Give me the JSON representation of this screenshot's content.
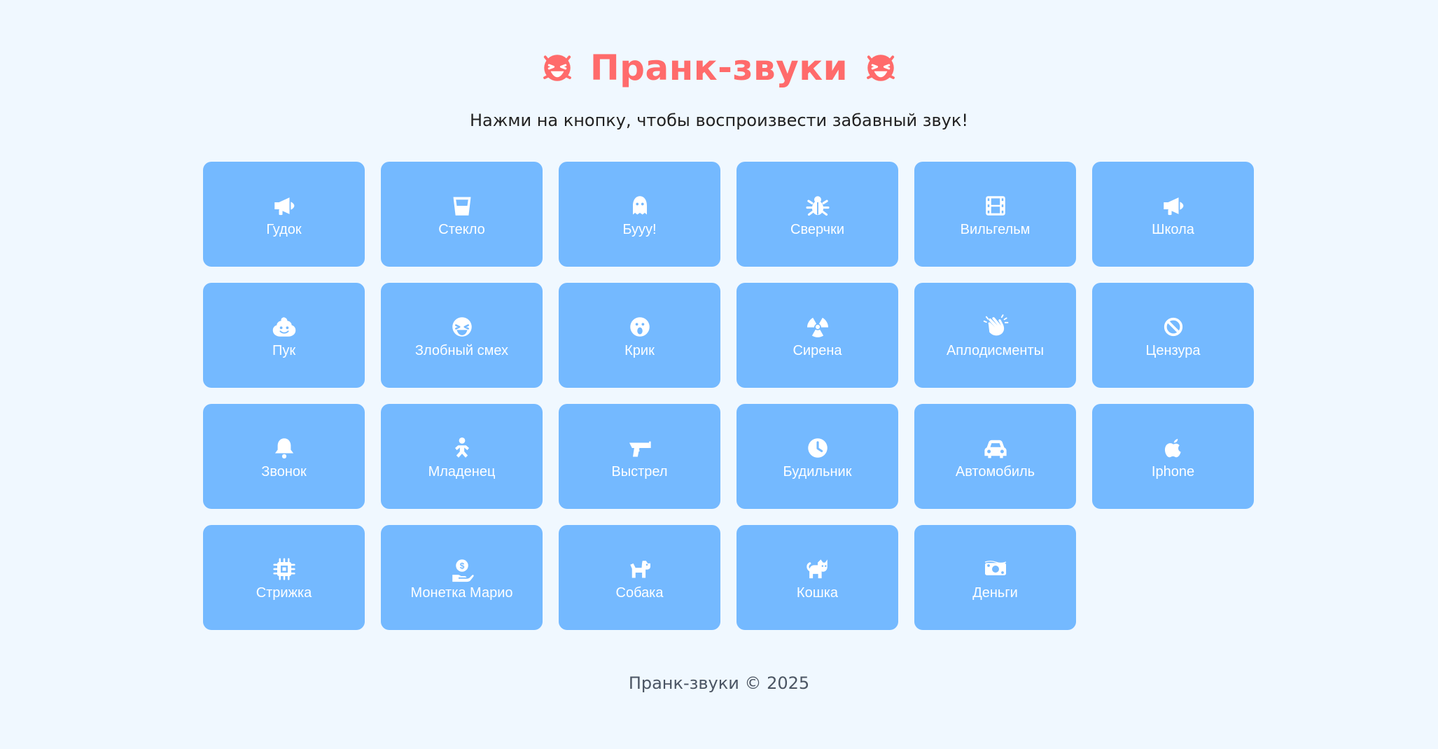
{
  "header": {
    "title": "Пранк-звуки",
    "subtitle": "Нажми на кнопку, чтобы воспроизвести забавный звук!",
    "title_icon_left": "laugh-squint-icon",
    "title_icon_right": "laugh-squint-icon"
  },
  "buttons": [
    {
      "label": "Гудок",
      "icon": "megaphone-icon"
    },
    {
      "label": "Стекло",
      "icon": "glass-icon"
    },
    {
      "label": "Бууу!",
      "icon": "ghost-icon"
    },
    {
      "label": "Сверчки",
      "icon": "bug-icon"
    },
    {
      "label": "Вильгельм",
      "icon": "film-icon"
    },
    {
      "label": "Школа",
      "icon": "megaphone-icon"
    },
    {
      "label": "Пук",
      "icon": "poop-icon"
    },
    {
      "label": "Злобный смех",
      "icon": "laugh-squint-icon"
    },
    {
      "label": "Крик",
      "icon": "surprise-icon"
    },
    {
      "label": "Сирена",
      "icon": "radiation-icon"
    },
    {
      "label": "Аплодисменты",
      "icon": "hands-clapping-icon"
    },
    {
      "label": "Цензура",
      "icon": "ban-icon"
    },
    {
      "label": "Звонок",
      "icon": "bell-icon"
    },
    {
      "label": "Младенец",
      "icon": "baby-icon"
    },
    {
      "label": "Выстрел",
      "icon": "gun-icon"
    },
    {
      "label": "Будильник",
      "icon": "clock-icon"
    },
    {
      "label": "Автомобиль",
      "icon": "car-icon"
    },
    {
      "label": "Iphone",
      "icon": "apple-icon"
    },
    {
      "label": "Стрижка",
      "icon": "microchip-icon"
    },
    {
      "label": "Монетка Марио",
      "icon": "coin-hand-icon"
    },
    {
      "label": "Собака",
      "icon": "dog-icon"
    },
    {
      "label": "Кошка",
      "icon": "cat-icon"
    },
    {
      "label": "Деньги",
      "icon": "money-bill-icon"
    }
  ],
  "footer": {
    "text": "Пранк-звуки © 2025"
  },
  "colors": {
    "background": "#f0f8ff",
    "button": "#74b9ff",
    "title": "#ff6b6b",
    "text": "#222222",
    "footer": "#4b5563"
  }
}
